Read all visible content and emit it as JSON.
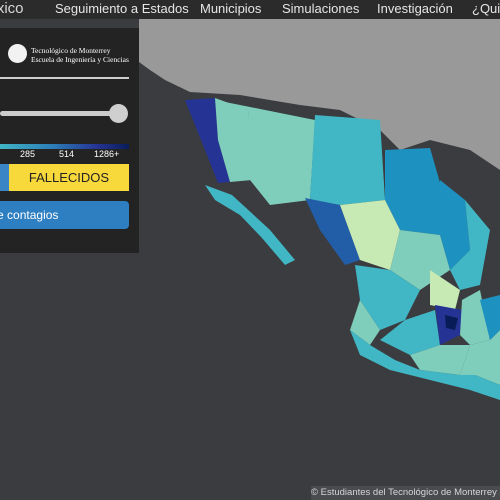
{
  "navbar": {
    "brand": "México",
    "links": [
      "Seguimiento a Estados",
      "Municipios",
      "Simulaciones",
      "Investigación",
      "¿Quiénes somos?"
    ]
  },
  "panel": {
    "logo_line1": "Tecnológico de Monterrey",
    "logo_line2": "Escuela de Ingeniería y Ciencias",
    "slider_value_pct": 100,
    "legend_ticks": [
      "285",
      "514",
      "1286+"
    ],
    "fallecidos_label": "FALLECIDOS",
    "main_button_label": "Mapa de contagios"
  },
  "footer": {
    "text": "© Estudiantes del Tecnológico de Monterrey"
  },
  "colors": {
    "page_bg": "#3b3c40",
    "land_bg": "#999999",
    "panel_bg": "#232323",
    "accent_yellow": "#f8d93c",
    "accent_blue": "#2d7fc2",
    "choropleth": [
      "#c7e9b4",
      "#7fcdbb",
      "#41b6c4",
      "#1d91c0",
      "#225ea8",
      "#253494",
      "#081d58"
    ]
  }
}
